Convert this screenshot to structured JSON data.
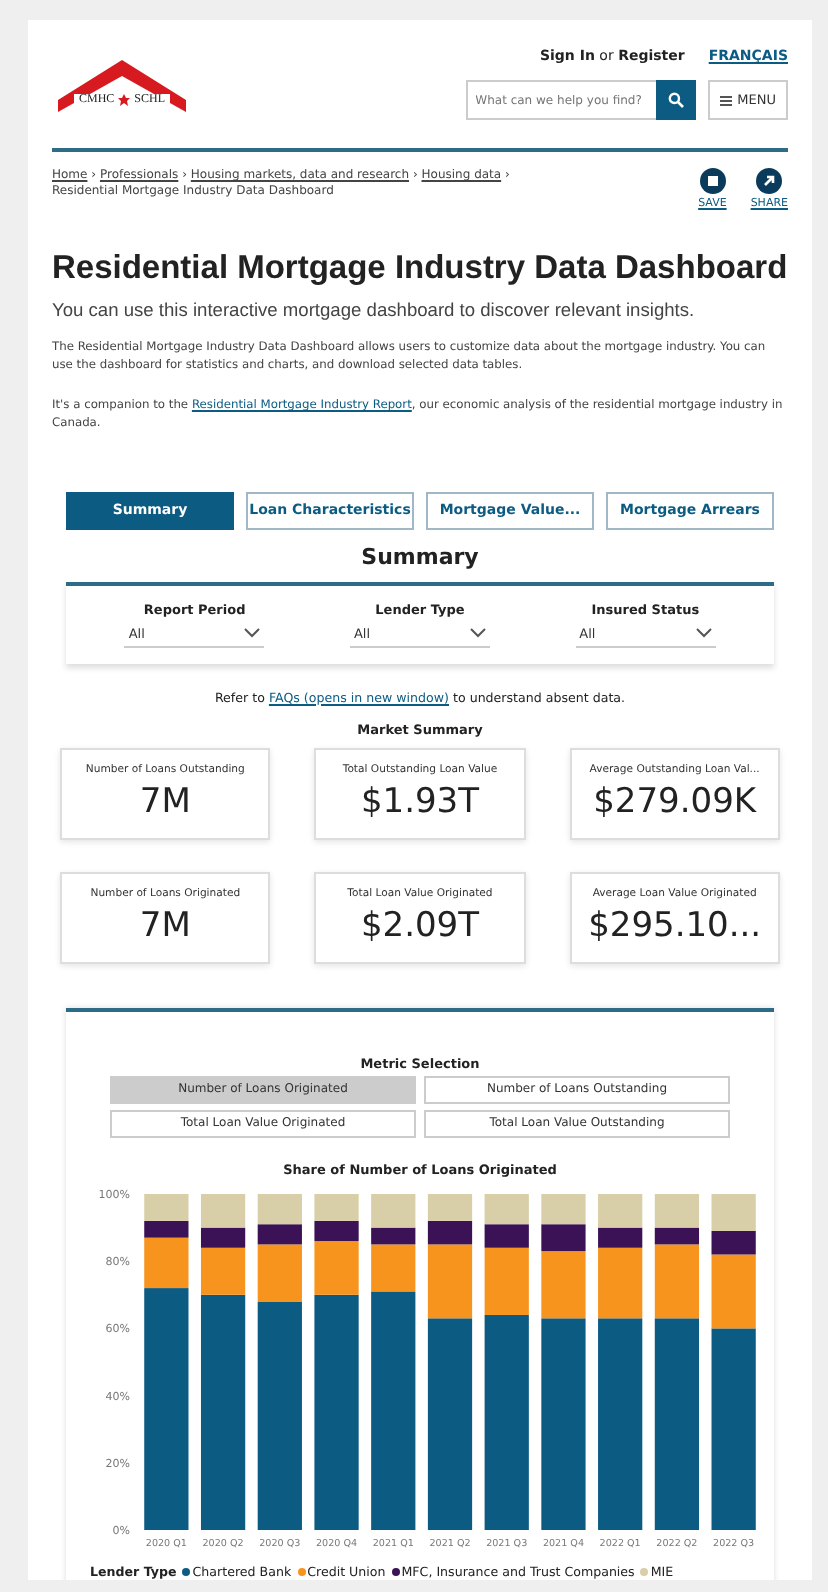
{
  "header": {
    "logo": {
      "left": "CMHC",
      "right": "SCHL"
    },
    "sign_in": "Sign In",
    "or": "or",
    "register": "Register",
    "language": "FRANÇAIS",
    "search": {
      "placeholder": "What can we help you find?"
    },
    "menu": "MENU"
  },
  "breadcrumb_separator": "›",
  "breadcrumb": [
    {
      "label": "Home",
      "link": true
    },
    {
      "label": "Professionals",
      "link": true
    },
    {
      "label": "Housing markets, data and research",
      "link": true
    },
    {
      "label": "Housing data",
      "link": true
    },
    {
      "label": "Residential Mortgage Industry Data Dashboard",
      "link": false
    }
  ],
  "actions": [
    {
      "kind": "save",
      "label": "SAVE"
    },
    {
      "kind": "share",
      "label": "SHARE"
    }
  ],
  "title": "Residential Mortgage Industry Data Dashboard",
  "subtitle": "You can use this interactive mortgage dashboard to discover relevant insights.",
  "intro": "The Residential Mortgage Industry Data Dashboard allows users to customize data about the mortgage industry. You can use the dashboard for statistics and charts, and download selected data tables.",
  "companion": {
    "before": "It's a companion to the ",
    "link": "Residential Mortgage Industry Report",
    "after": ", our economic analysis of the residential mortgage industry in Canada."
  },
  "tabs": [
    {
      "label": "Summary",
      "selected": true
    },
    {
      "label": "Loan Characteristics",
      "selected": false
    },
    {
      "label": "Mortgage Value...",
      "selected": false
    },
    {
      "label": "Mortgage Arrears",
      "selected": false
    }
  ],
  "section_title": "Summary",
  "filters": [
    {
      "label": "Report Period",
      "value": "All"
    },
    {
      "label": "Lender Type",
      "value": "All"
    },
    {
      "label": "Insured Status",
      "value": "All"
    }
  ],
  "faq_note": {
    "before": "Refer to ",
    "link": "FAQs (opens in new window)",
    "after": " to understand absent data."
  },
  "market_summary": {
    "title": "Market Summary",
    "cards": [
      {
        "label": "Number of Loans Outstanding",
        "value": "7M"
      },
      {
        "label": "Total Outstanding Loan Value",
        "value": "$1.93T"
      },
      {
        "label": "Average Outstanding Loan Val...",
        "value": "$279.09K"
      },
      {
        "label": "Number of Loans Originated",
        "value": "7M"
      },
      {
        "label": "Total Loan Value Originated",
        "value": "$2.09T"
      },
      {
        "label": "Average Loan Value Originated",
        "value": "$295.10..."
      }
    ]
  },
  "metric_selection": {
    "title": "Metric Selection",
    "options": [
      {
        "label": "Number of Loans Originated",
        "selected": true
      },
      {
        "label": "Number of Loans Outstanding",
        "selected": false
      },
      {
        "label": "Total Loan Value Originated",
        "selected": false
      },
      {
        "label": "Total Loan Value Outstanding",
        "selected": false
      }
    ]
  },
  "chart": {
    "legend_title": "Lender Type",
    "chart_data": {
      "type": "bar",
      "stacked": true,
      "title": "Share of Number of Loans Originated",
      "categories": [
        "2020 Q1",
        "2020 Q2",
        "2020 Q3",
        "2020 Q4",
        "2021 Q1",
        "2021 Q2",
        "2021 Q3",
        "2021 Q4",
        "2022 Q1",
        "2022 Q2",
        "2022 Q3"
      ],
      "ylim": [
        0,
        100
      ],
      "yticks": [
        {
          "value": 0,
          "label": "0%"
        },
        {
          "value": 20,
          "label": "20%"
        },
        {
          "value": 40,
          "label": "40%"
        },
        {
          "value": 60,
          "label": "60%"
        },
        {
          "value": 80,
          "label": "80%"
        },
        {
          "value": 100,
          "label": "100%"
        }
      ],
      "series": [
        {
          "name": "Chartered Bank",
          "color": "#0b5b83",
          "values": [
            72,
            70,
            68,
            70,
            71,
            63,
            64,
            63,
            63,
            63,
            60
          ]
        },
        {
          "name": "Credit Union",
          "color": "#f7941d",
          "values": [
            15,
            14,
            17,
            16,
            14,
            22,
            20,
            20,
            21,
            22,
            22
          ]
        },
        {
          "name": "MFC, Insurance and Trust Companies",
          "color": "#3b1256",
          "values": [
            5,
            6,
            6,
            6,
            5,
            7,
            7,
            8,
            6,
            5,
            7
          ]
        },
        {
          "name": "MIE",
          "color": "#d8cfa8",
          "values": [
            8,
            10,
            9,
            8,
            10,
            8,
            9,
            9,
            10,
            10,
            11
          ]
        }
      ]
    }
  }
}
